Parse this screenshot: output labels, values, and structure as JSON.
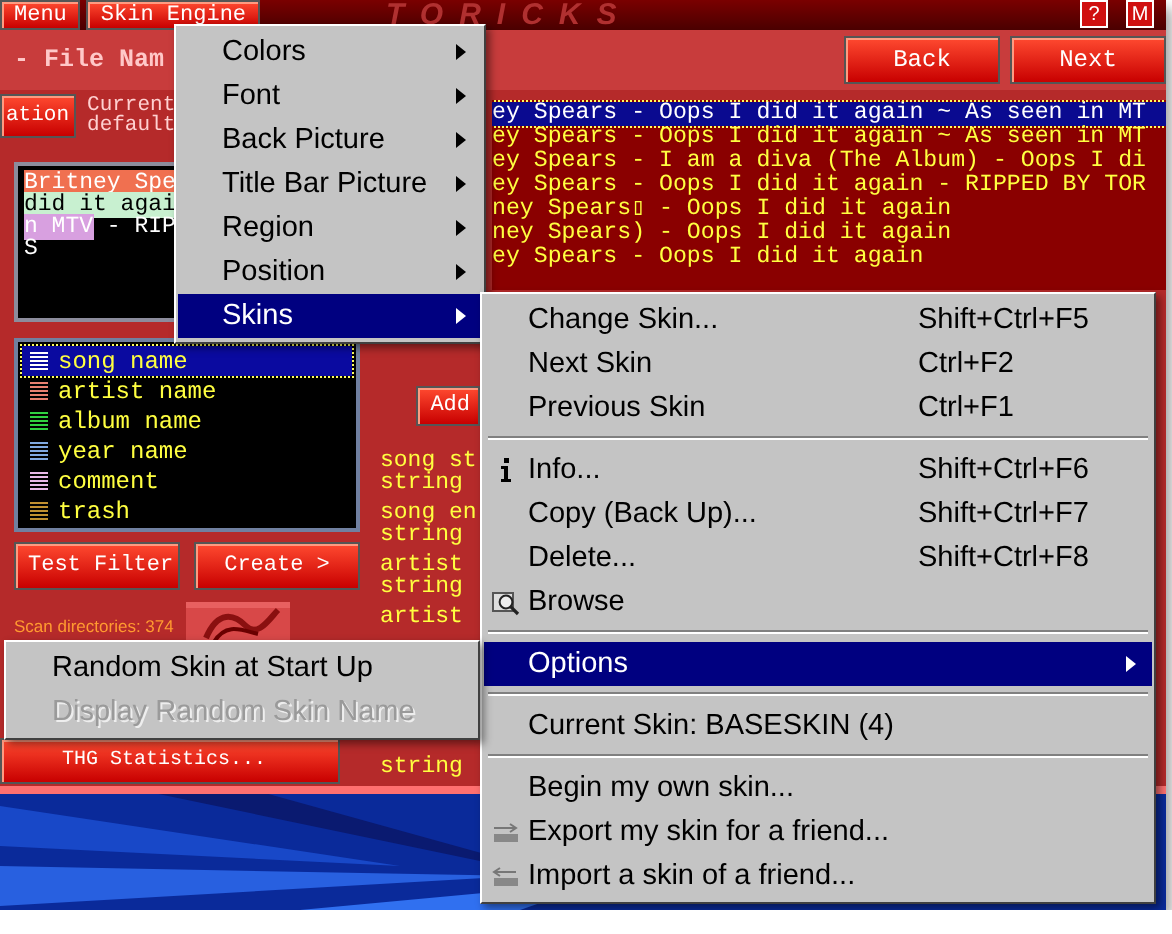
{
  "top_bar": {
    "menu_buttons": [
      "Menu",
      "Skin Engine"
    ],
    "logo": "TORICKS",
    "corner_buttons": [
      "?",
      "M"
    ]
  },
  "header": {
    "title": "- File Nam",
    "nav_buttons": [
      "Back",
      "Next"
    ]
  },
  "info": {
    "button": "ation",
    "lines": [
      "Current",
      "default"
    ]
  },
  "preview_lines": [
    {
      "segments": [
        {
          "text": "Britney Spe",
          "color": "#f07050"
        }
      ]
    },
    {
      "segments": [
        {
          "text": "did it agai",
          "color": "#c8f0d0"
        }
      ]
    },
    {
      "segments": [
        {
          "text": "n MTV",
          "color": "#d8a0e0"
        },
        {
          "text": " - RIP"
        }
      ]
    },
    {
      "segments": [
        {
          "text": "S"
        }
      ]
    }
  ],
  "file_list": [
    {
      "text": "ey Spears - Oops I did it again ~ As seen in MT",
      "selected": true
    },
    {
      "text": "ey Spears - Oops I did it again ~ As seen in MT",
      "selected": false
    },
    {
      "text": "ey Spears - I am a diva (The Album) - Oops I di",
      "selected": false
    },
    {
      "text": "ey Spears - Oops I did it again - RIPPED BY TOR",
      "selected": false
    },
    {
      "text": "ney Spears▯ - Oops I did it again",
      "selected": false
    },
    {
      "text": "ney Spears) - Oops I did it again",
      "selected": false
    },
    {
      "text": "ey Spears - Oops I did it again",
      "selected": false
    }
  ],
  "filter_items": [
    {
      "label": "song name",
      "color": "#ffffff",
      "selected": true
    },
    {
      "label": "artist name",
      "color": "#e88070",
      "selected": false
    },
    {
      "label": "album name",
      "color": "#30d040",
      "selected": false
    },
    {
      "label": "year name",
      "color": "#80a8e0",
      "selected": false
    },
    {
      "label": "comment",
      "color": "#e8b8e8",
      "selected": false
    },
    {
      "label": "trash",
      "color": "#c09030",
      "selected": false
    }
  ],
  "filter_buttons": [
    "Test Filter",
    "Create >"
  ],
  "scan_text": "Scan directories: 374",
  "side_button": "Add",
  "rule_groups": [
    {
      "lines": [
        "song st",
        "string"
      ]
    },
    {
      "lines": [
        "song en",
        "string"
      ]
    },
    {
      "lines": [
        "artist",
        "string"
      ]
    },
    {
      "lines": [
        "artist"
      ]
    },
    {
      "lines": [
        "string"
      ]
    }
  ],
  "stats_button": "THG Statistics...",
  "skin_engine_menu": {
    "items": [
      {
        "label": "Colors",
        "selected": false
      },
      {
        "label": "Font",
        "selected": false
      },
      {
        "label": "Back Picture",
        "selected": false
      },
      {
        "label": "Title Bar Picture",
        "selected": false
      },
      {
        "label": "Region",
        "selected": false
      },
      {
        "label": "Position",
        "selected": false
      },
      {
        "label": "Skins",
        "selected": true
      }
    ]
  },
  "skins_menu": {
    "items": [
      {
        "kind": "item",
        "label": "Change Skin...",
        "shortcut": "Shift+Ctrl+F5"
      },
      {
        "kind": "item",
        "label": "Next Skin",
        "shortcut": "Ctrl+F2"
      },
      {
        "kind": "item",
        "label": "Previous Skin",
        "shortcut": "Ctrl+F1"
      },
      {
        "kind": "separator"
      },
      {
        "kind": "info",
        "label": "Info...",
        "shortcut": "Shift+Ctrl+F6"
      },
      {
        "kind": "item",
        "label": "Copy (Back Up)...",
        "shortcut": "Shift+Ctrl+F7"
      },
      {
        "kind": "item",
        "label": "Delete...",
        "shortcut": "Shift+Ctrl+F8"
      },
      {
        "kind": "browse",
        "label": "Browse"
      },
      {
        "kind": "separator"
      },
      {
        "kind": "submenu",
        "label": "Options",
        "selected": true
      },
      {
        "kind": "separator"
      },
      {
        "kind": "item",
        "label": "Current Skin: BASESKIN (4)"
      },
      {
        "kind": "separator"
      },
      {
        "kind": "item",
        "label": "Begin my own skin..."
      },
      {
        "kind": "export",
        "label": "Export my skin for a friend..."
      },
      {
        "kind": "import",
        "label": "Import a skin of a friend..."
      }
    ]
  },
  "options_menu": {
    "items": [
      {
        "label": "Random Skin at Start Up",
        "disabled": false
      },
      {
        "label": "Display Random Skin Name",
        "disabled": true
      }
    ]
  }
}
